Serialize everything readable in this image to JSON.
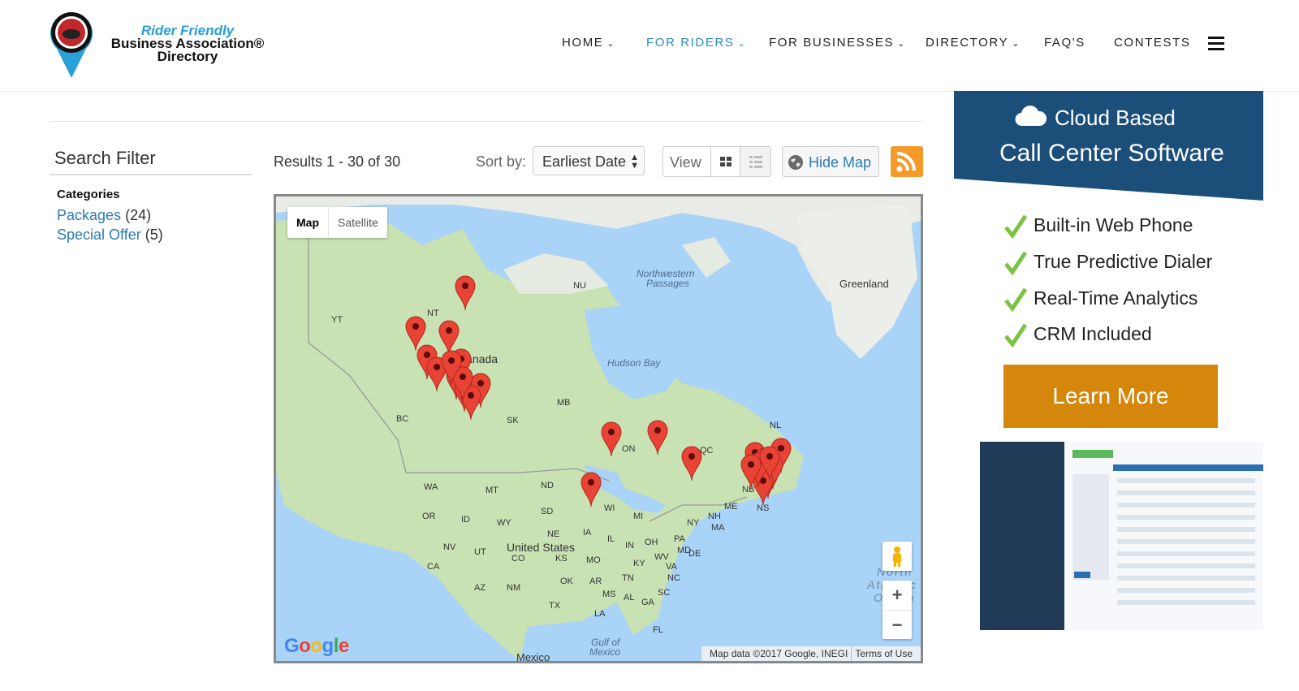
{
  "header": {
    "logo": {
      "line1": "Rider Friendly",
      "line2": "Business Association®",
      "line3": "Directory"
    },
    "nav": [
      {
        "label": "HOME",
        "dropdown": true,
        "active": false
      },
      {
        "label": "FOR RIDERS",
        "dropdown": true,
        "active": true
      },
      {
        "label": "FOR BUSINESSES",
        "dropdown": true,
        "active": false
      },
      {
        "label": "DIRECTORY",
        "dropdown": true,
        "active": false
      },
      {
        "label": "FAQ'S",
        "dropdown": false,
        "active": false
      },
      {
        "label": "CONTESTS",
        "dropdown": false,
        "active": false
      }
    ],
    "menu_icon": "hamburger-icon",
    "active_color": "#2a8ab8"
  },
  "filter": {
    "title": "Search Filter",
    "categories_title": "Categories",
    "categories": [
      {
        "label": "Packages",
        "count": "(24)"
      },
      {
        "label": "Special Offer",
        "count": "(5)"
      }
    ]
  },
  "toolbar": {
    "results": "Results 1 - 30 of 30",
    "sort_label": "Sort by:",
    "sort_value": "Earliest Date",
    "view_label": "View",
    "hide_map": "Hide Map",
    "icons": [
      "grid-view-icon",
      "list-view-icon",
      "globe-icon",
      "rss-icon"
    ]
  },
  "map": {
    "type_map": "Map",
    "type_satellite": "Satellite",
    "labels": {
      "greenland": "Greenland",
      "nw_passages_1": "Northwestern",
      "nw_passages_2": "Passages",
      "nu": "NU",
      "nt": "NT",
      "yt": "YT",
      "canada": "Canada",
      "hudson_bay": "Hudson Bay",
      "mb": "MB",
      "bc": "BC",
      "sk": "SK",
      "on": "ON",
      "qc": "QC",
      "nl": "NL",
      "nb": "NB",
      "ns": "NS",
      "me": "ME",
      "nh": "NH",
      "ma": "MA",
      "ny": "NY",
      "wa": "WA",
      "mt": "MT",
      "nd": "ND",
      "sd": "SD",
      "or": "OR",
      "id": "ID",
      "wy": "WY",
      "ne": "NE",
      "ia": "IA",
      "wi": "WI",
      "mi": "MI",
      "il": "IL",
      "in": "IN",
      "oh": "OH",
      "pa": "PA",
      "md": "MD",
      "de": "DE",
      "wv": "WV",
      "va": "VA",
      "ky": "KY",
      "nv": "NV",
      "ut": "UT",
      "us": "United States",
      "ks": "KS",
      "co": "CO",
      "mo": "MO",
      "ca": "CA",
      "az": "AZ",
      "nm": "NM",
      "ok": "OK",
      "ar": "AR",
      "tn": "TN",
      "nc": "NC",
      "sc": "SC",
      "tx": "TX",
      "la": "LA",
      "ms": "MS",
      "al": "AL",
      "ga": "GA",
      "fl": "FL",
      "gulf1": "Gulf of",
      "gulf2": "Mexico",
      "mexico": "Mexico",
      "north": "North",
      "atlantic": "Atlantic",
      "ocean": "Ocean"
    },
    "attribution": "Map data ©2017 Google, INEGI",
    "terms": "Terms of Use",
    "google": "Google",
    "zoom_in": "+",
    "zoom_out": "−",
    "marker_count": 26
  },
  "ad": {
    "line1": "Cloud Based",
    "line2": "Call Center Software",
    "features": [
      "Built-in Web Phone",
      "True Predictive Dialer",
      "Real-Time Analytics",
      "CRM Included"
    ],
    "cta": "Learn More",
    "brand_color": "#1b4f7a",
    "cta_color": "#d4870a",
    "check_color": "#7cc242"
  }
}
